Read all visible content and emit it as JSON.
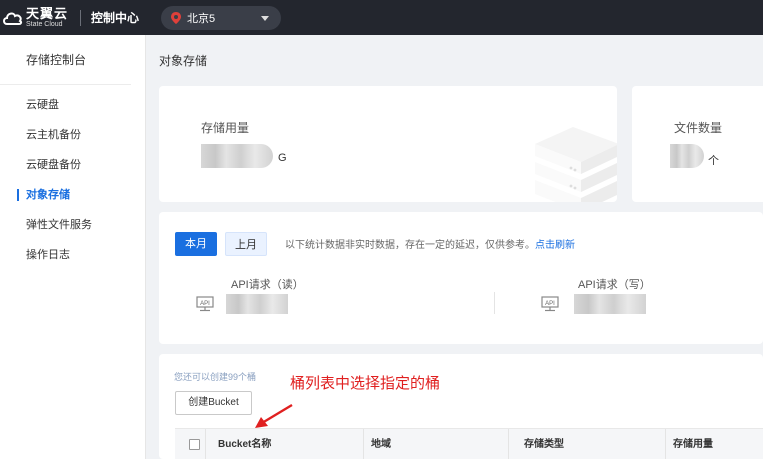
{
  "topbar": {
    "logo_cn": "天翼云",
    "logo_en": "State Cloud",
    "console": "控制中心",
    "region": "北京5"
  },
  "sidebar": {
    "title": "存储控制台",
    "items": [
      {
        "label": "云硬盘",
        "active": false
      },
      {
        "label": "云主机备份",
        "active": false
      },
      {
        "label": "云硬盘备份",
        "active": false
      },
      {
        "label": "对象存储",
        "active": true
      },
      {
        "label": "弹性文件服务",
        "active": false
      },
      {
        "label": "操作日志",
        "active": false
      }
    ]
  },
  "main": {
    "page_title": "对象存储",
    "storage_usage": {
      "label": "存储用量",
      "unit": "G"
    },
    "file_count": {
      "label": "文件数量",
      "unit": "个"
    },
    "stats": {
      "tab_current": "本月",
      "tab_previous": "上月",
      "tip": "以下统计数据非实时数据，存在一定的延迟，仅供参考。",
      "refresh": "点击刷新",
      "api_read": "API请求（读）",
      "api_write": "API请求（写）",
      "api_icon_text": "API"
    },
    "bucket": {
      "remain": "您还可以创建99个桶",
      "create_label": "创建Bucket",
      "columns": [
        "Bucket名称",
        "地域",
        "存储类型",
        "存储用量"
      ]
    },
    "annotation": "桶列表中选择指定的桶"
  },
  "colors": {
    "topbar": "#23262e",
    "accent": "#1a6fe0",
    "annotation": "#e02020"
  }
}
